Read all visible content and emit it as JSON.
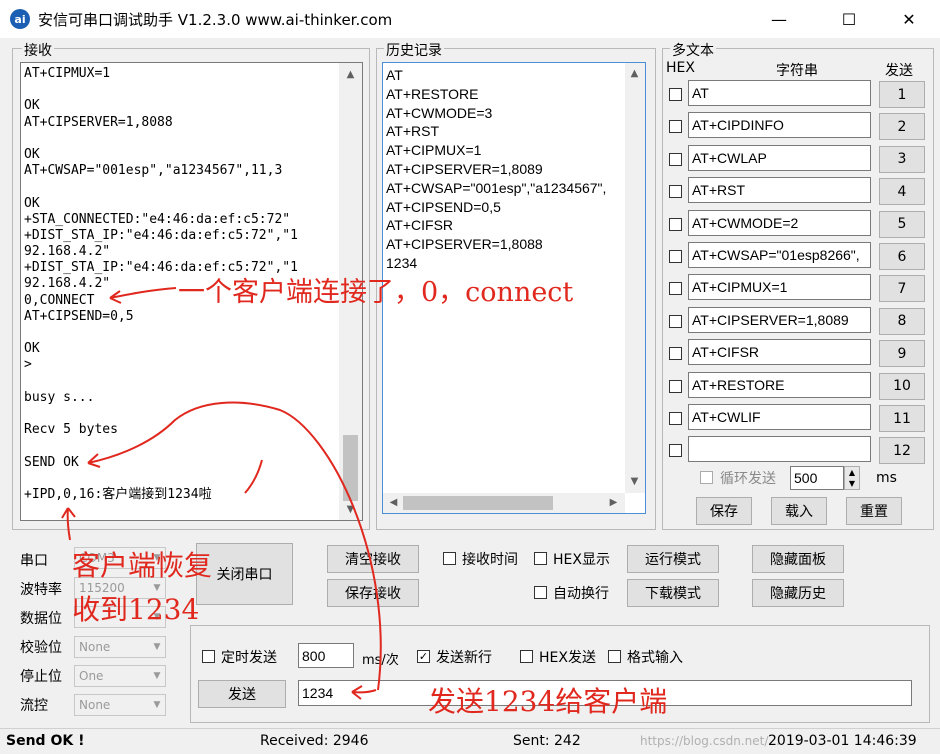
{
  "window": {
    "title": "安信可串口调试助手 V1.2.3.0    www.ai-thinker.com",
    "icon_name": "ai-thinker-logo-icon",
    "minimize": "—",
    "maximize": "☐",
    "close": "✕"
  },
  "receive": {
    "title": "接收",
    "lines": [
      "AT+CIPMUX=1",
      "",
      "OK",
      "AT+CIPSERVER=1,8088",
      "",
      "OK",
      "AT+CWSAP=\"001esp\",\"a1234567\",11,3",
      "",
      "OK",
      "+STA_CONNECTED:\"e4:46:da:ef:c5:72\"",
      "+DIST_STA_IP:\"e4:46:da:ef:c5:72\",\"1",
      "92.168.4.2\"",
      "+DIST_STA_IP:\"e4:46:da:ef:c5:72\",\"1",
      "92.168.4.2\"",
      "0,CONNECT",
      "AT+CIPSEND=0,5",
      "",
      "OK",
      ">",
      "",
      "busy s...",
      "",
      "Recv 5 bytes",
      "",
      "SEND OK",
      "",
      "+IPD,0,16:客户端接到1234啦"
    ]
  },
  "history": {
    "title": "历史记录",
    "items": [
      "AT",
      "AT+RESTORE",
      "AT+CWMODE=3",
      "AT+RST",
      "AT+CIPMUX=1",
      "AT+CIPSERVER=1,8089",
      "AT+CWSAP=\"001esp\",\"a1234567\",",
      "AT+CIPSEND=0,5",
      "AT+CIFSR",
      "AT+CIPSERVER=1,8088",
      "1234"
    ]
  },
  "multitext": {
    "title": "多文本",
    "col_hex": "HEX",
    "col_string": "字符串",
    "col_send": "发送",
    "rows": [
      {
        "text": "AT",
        "btn": "1"
      },
      {
        "text": "AT+CIPDINFO",
        "btn": "2"
      },
      {
        "text": "AT+CWLAP",
        "btn": "3"
      },
      {
        "text": "AT+RST",
        "btn": "4"
      },
      {
        "text": "AT+CWMODE=2",
        "btn": "5"
      },
      {
        "text": "AT+CWSAP=\"01esp8266\",",
        "btn": "6"
      },
      {
        "text": "AT+CIPMUX=1",
        "btn": "7"
      },
      {
        "text": "AT+CIPSERVER=1,8089",
        "btn": "8"
      },
      {
        "text": "AT+CIFSR",
        "btn": "9"
      },
      {
        "text": "AT+RESTORE",
        "btn": "10"
      },
      {
        "text": "AT+CWLIF",
        "btn": "11"
      },
      {
        "text": "",
        "btn": "12"
      }
    ],
    "loop_label": "循环发送",
    "loop_value": "500",
    "loop_unit": "ms",
    "save": "保存",
    "load": "载入",
    "reset": "重置"
  },
  "serial": {
    "port_label": "串口",
    "port_value": "COM3",
    "baud_label": "波特率",
    "baud_value": "115200",
    "databits_label": "数据位",
    "parity_label": "校验位",
    "parity_value": "None",
    "stopbits_label": "停止位",
    "stopbits_value": "One",
    "flow_label": "流控",
    "flow_value": "None",
    "close_port": "关闭串口"
  },
  "controls": {
    "clear_receive": "清空接收",
    "save_receive": "保存接收",
    "recv_time": "接收时间",
    "hex_display": "HEX显示",
    "auto_wrap": "自动换行",
    "run_mode": "运行模式",
    "download_mode": "下载模式",
    "hide_panel": "隐藏面板",
    "hide_history": "隐藏历史"
  },
  "send": {
    "timed_send": "定时发送",
    "interval_value": "800",
    "interval_unit": "ms/次",
    "send_newline": "发送新行",
    "hex_send": "HEX发送",
    "format_input": "格式输入",
    "send_button": "发送",
    "input_value": "1234",
    "send_newline_checked": "✓"
  },
  "status": {
    "left": "Send OK !",
    "received": "Received: 2946",
    "sent": "Sent: 242",
    "datetime": "2019-03-01 14:46:39",
    "watermark": "https://blog.csdn.net/..."
  },
  "annotations": {
    "connect": "一个客户端连接了，0，connect",
    "client_reply_1": "客户端恢复",
    "client_reply_2": "收到1234",
    "send_note": "发送1234给客户端",
    "color": "#e0281e"
  }
}
